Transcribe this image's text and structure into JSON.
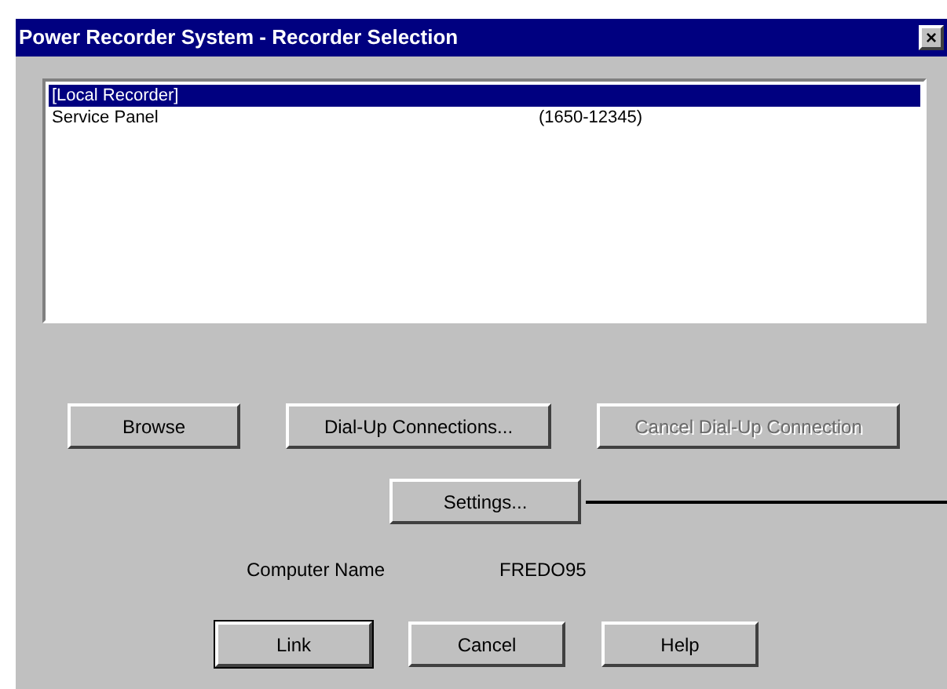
{
  "window": {
    "title": "Power Recorder System - Recorder Selection",
    "close": "×"
  },
  "recorders": [
    {
      "name": "[Local Recorder]",
      "selected": true
    },
    {
      "name": "Service Panel",
      "number": "(1650-12345)",
      "selected": false
    }
  ],
  "buttons": [
    {
      "label": "Browse",
      "disabled": false
    },
    {
      "label": "Dial-Up Connections...",
      "disabled": false
    },
    {
      "label": "Cancel Dial-Up Connection",
      "disabled": true
    }
  ],
  "settings_button": {
    "label": "Settings..."
  },
  "computer_name": {
    "label": "Computer Name",
    "value": "FREDO95"
  },
  "footer_buttons": [
    {
      "label": "Link",
      "default": true
    },
    {
      "label": "Cancel",
      "default": false
    },
    {
      "label": "Help",
      "default": false
    }
  ]
}
